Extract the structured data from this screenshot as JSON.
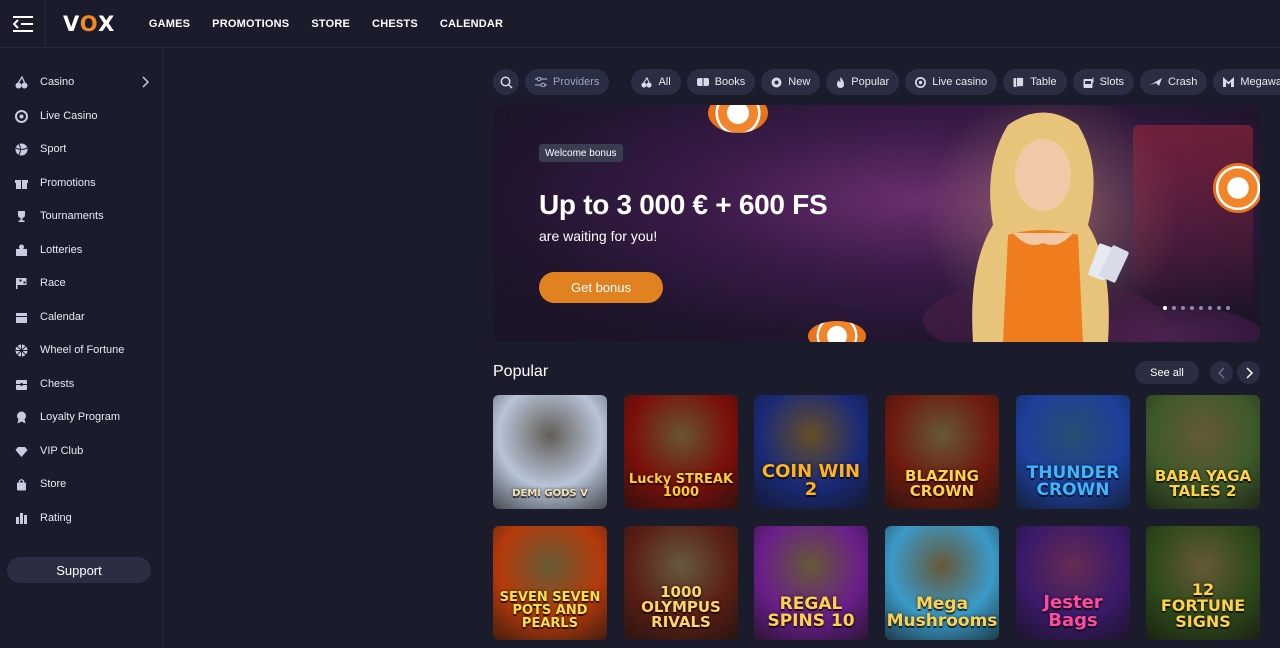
{
  "header": {
    "logo": {
      "left": "V",
      "o": "O",
      "right": "X"
    },
    "nav": [
      "GAMES",
      "PROMOTIONS",
      "STORE",
      "CHESTS",
      "CALENDAR"
    ]
  },
  "sidebar": {
    "items": [
      {
        "label": "Casino",
        "icon": "cherries-icon"
      },
      {
        "label": "Live Casino",
        "icon": "chip-icon"
      },
      {
        "label": "Sport",
        "icon": "ball-icon"
      },
      {
        "label": "Promotions",
        "icon": "gift-icon"
      },
      {
        "label": "Tournaments",
        "icon": "trophy-icon"
      },
      {
        "label": "Lotteries",
        "icon": "lottery-icon"
      },
      {
        "label": "Race",
        "icon": "flag-icon"
      },
      {
        "label": "Calendar",
        "icon": "calendar-icon"
      },
      {
        "label": "Wheel of Fortune",
        "icon": "wheel-icon"
      },
      {
        "label": "Chests",
        "icon": "chest-icon"
      },
      {
        "label": "Loyalty Program",
        "icon": "medal-icon"
      },
      {
        "label": "VIP Club",
        "icon": "diamond-icon"
      },
      {
        "label": "Store",
        "icon": "bag-icon"
      },
      {
        "label": "Rating",
        "icon": "rating-icon"
      }
    ],
    "support": "Support"
  },
  "filters": {
    "providers": "Providers",
    "chips": [
      "All",
      "Books",
      "New",
      "Popular",
      "Live casino",
      "Table",
      "Slots",
      "Crash",
      "Megaways"
    ]
  },
  "banner": {
    "badge": "Welcome bonus",
    "title": "Up to 3 000 € + 600 FS",
    "subtitle": "are waiting for you!",
    "button": "Get bonus",
    "slides": 8,
    "active_slide": 1
  },
  "popular": {
    "title": "Popular",
    "see_all": "See all",
    "games": [
      {
        "name": "DEMI GODS V",
        "bg": "#b8c4d8",
        "color": "#f2e2b0"
      },
      {
        "name": "Lucky STREAK 1000",
        "bg": "#7a0f0a",
        "color": "#ffcc33"
      },
      {
        "name": "COIN WIN 2",
        "bg": "#1a2a78",
        "color": "#ffb31a"
      },
      {
        "name": "BLAZING CROWN",
        "bg": "#6e1a0e",
        "color": "#ffd24a"
      },
      {
        "name": "THUNDER CROWN",
        "bg": "#1d3f9a",
        "color": "#3cb6ff"
      },
      {
        "name": "BABA YAGA TALES 2",
        "bg": "#3e5a2a",
        "color": "#ffd24a"
      },
      {
        "name": "SEVEN SEVEN POTS AND PEARLS",
        "bg": "#b53a0b",
        "color": "#ffe04a"
      },
      {
        "name": "1000 OLYMPUS RIVALS",
        "bg": "#5a1e14",
        "color": "#ffd56a"
      },
      {
        "name": "REGAL SPINS 10",
        "bg": "#6a1e8a",
        "color": "#ffd24a"
      },
      {
        "name": "Mega Mushrooms",
        "bg": "#3a9ac8",
        "color": "#ffd24a"
      },
      {
        "name": "Jester Bags",
        "bg": "#3a1a6a",
        "color": "#ff4aa0"
      },
      {
        "name": "12 FORTUNE SIGNS",
        "bg": "#2e4a1a",
        "color": "#ffd24a"
      }
    ]
  }
}
